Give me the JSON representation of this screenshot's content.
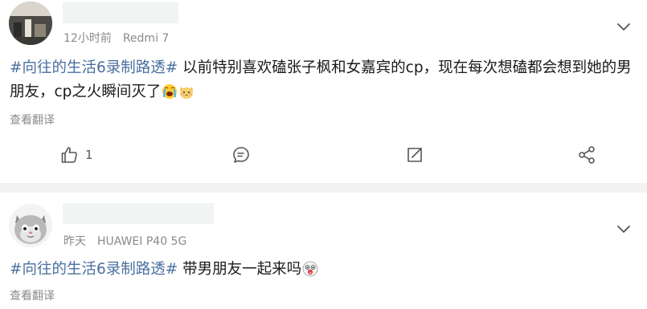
{
  "posts": [
    {
      "time": "12小时前",
      "device": "Redmi 7",
      "topic": "#向往的生活6录制路透#",
      "text": " 以前特别喜欢磕张子枫和女嘉宾的cp，现在每次想磕都会想到她的男朋友，cp之火瞬间灭了",
      "emojis": [
        "crying-face-emoji",
        "cat-hug-emoji"
      ],
      "translate_label": "查看翻译",
      "like_count": "1"
    },
    {
      "time": "昨天",
      "device": "HUAWEI P40 5G",
      "topic": "#向往的生活6录制路透#",
      "text": " 带男朋友一起来吗",
      "emojis": [
        "shocked-face-emoji"
      ],
      "translate_label": "查看翻译"
    }
  ],
  "icons": {
    "like": "thumbs-up-icon",
    "comment": "comment-icon",
    "repost": "repost-icon",
    "share": "share-icon",
    "more": "chevron-down-icon"
  },
  "colors": {
    "topic": "#4a6fa0",
    "meta": "#8a8a8a",
    "divider": "#f2f2f2",
    "name_placeholder": "#f0f4f3"
  }
}
